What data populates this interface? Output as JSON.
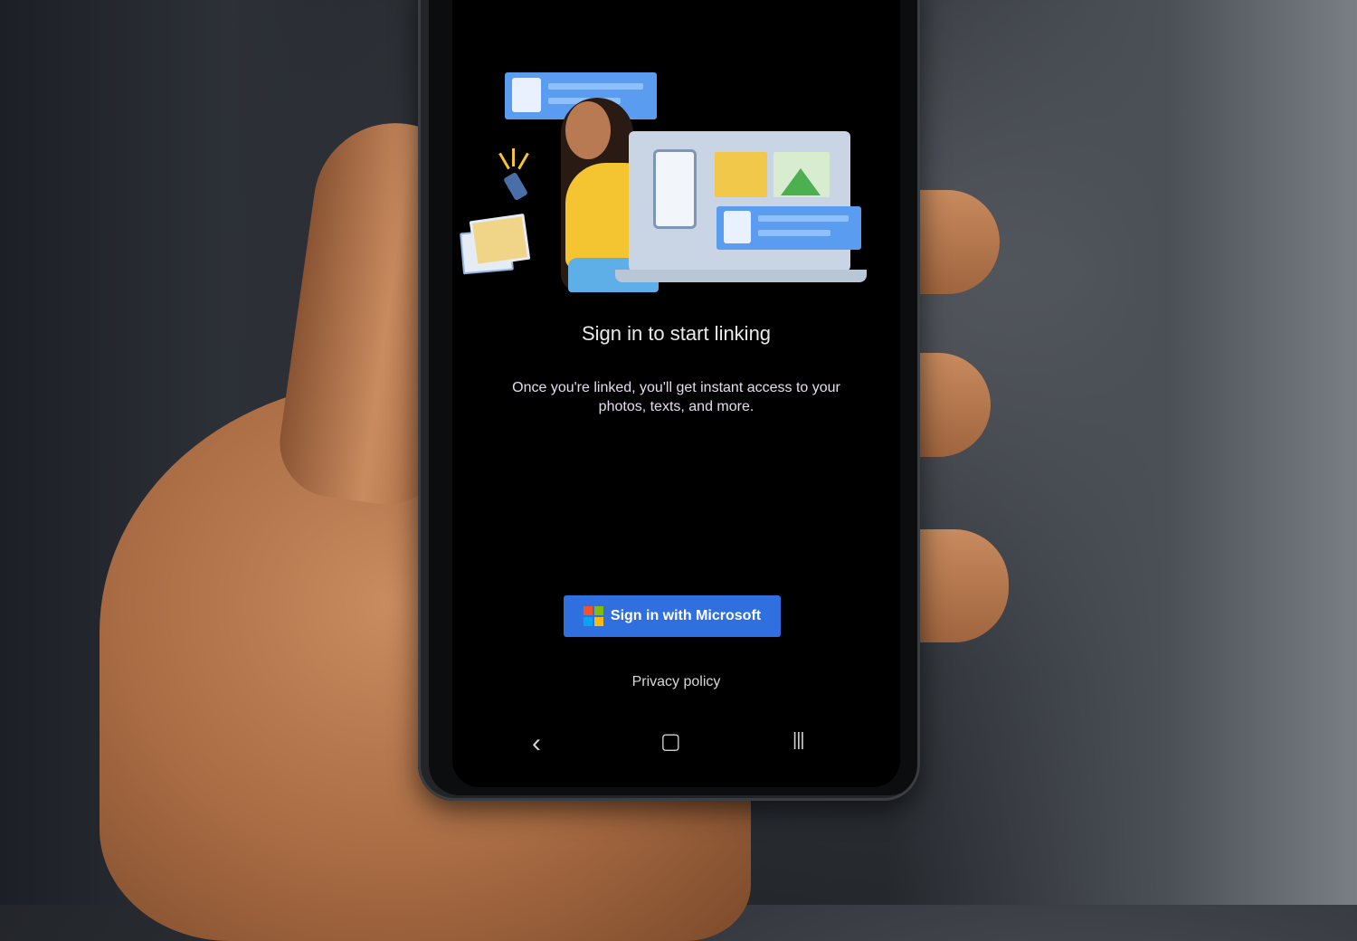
{
  "screen": {
    "title": "Sign in to start linking",
    "subtitle": "Once you're linked, you'll get instant access to your photos, texts, and more.",
    "signin_button": "Sign in with Microsoft",
    "privacy_link": "Privacy policy"
  },
  "nav": {
    "back_icon": "‹",
    "home_icon": "▢",
    "recents_icon": "|||"
  },
  "colors": {
    "button": "#2f6fe0",
    "ms_red": "#f35325",
    "ms_green": "#81bc06",
    "ms_blue": "#05a6f0",
    "ms_yellow": "#ffba08"
  },
  "icons": [
    "microsoft-logo-icon",
    "back-icon",
    "home-icon",
    "recents-icon"
  ]
}
